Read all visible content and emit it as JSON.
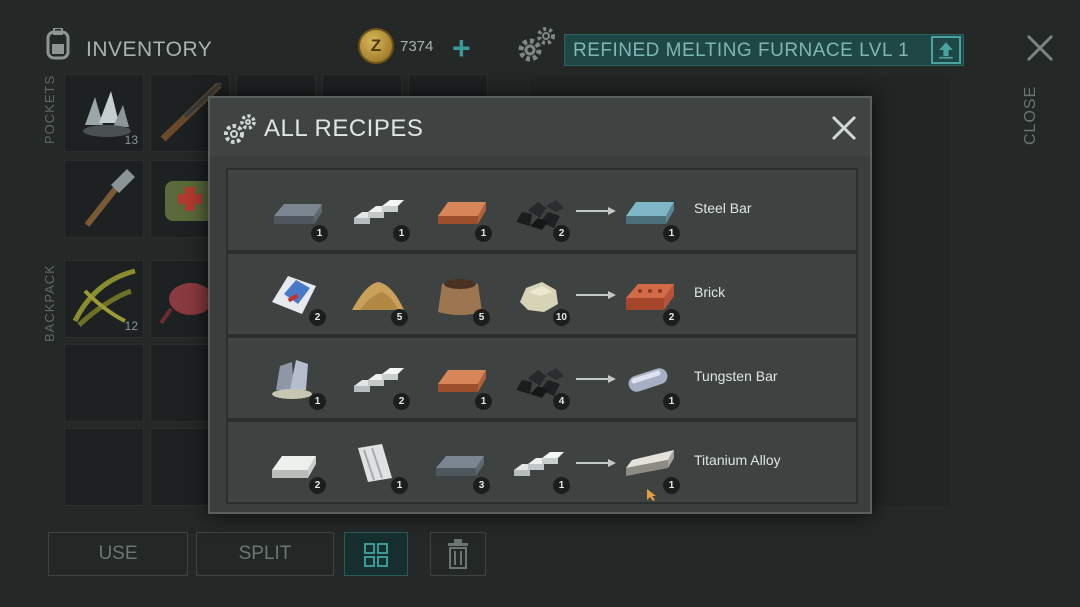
{
  "header": {
    "inventory_title": "INVENTORY",
    "coins": "7374",
    "coin_symbol": "Z",
    "plus_symbol": "+",
    "furnace_title": "REFINED MELTING FURNACE LVL 1",
    "close_label": "CLOSE"
  },
  "inventory": {
    "pockets_label": "POCKETS",
    "backpack_label": "BACKPACK",
    "slot_counts": [
      "13",
      "12"
    ]
  },
  "actions": {
    "use_label": "USE",
    "split_label": "SPLIT"
  },
  "modal": {
    "title": "ALL RECIPES",
    "recipes": [
      {
        "name": "Steel Bar",
        "ingredients": [
          {
            "icon": "iron-bar-icon",
            "count": "1"
          },
          {
            "icon": "silver-ingots-icon",
            "count": "1"
          },
          {
            "icon": "copper-bar-icon",
            "count": "1"
          },
          {
            "icon": "coal-icon",
            "count": "2"
          }
        ],
        "result": {
          "icon": "steel-bar-icon",
          "count": "1"
        }
      },
      {
        "name": "Brick",
        "ingredients": [
          {
            "icon": "cement-bag-icon",
            "count": "2"
          },
          {
            "icon": "sand-pile-icon",
            "count": "5"
          },
          {
            "icon": "soil-sack-icon",
            "count": "5"
          },
          {
            "icon": "stone-icon",
            "count": "10"
          }
        ],
        "result": {
          "icon": "brick-icon",
          "count": "2"
        }
      },
      {
        "name": "Tungsten Bar",
        "ingredients": [
          {
            "icon": "tungsten-ore-icon",
            "count": "1"
          },
          {
            "icon": "silver-ingots-icon",
            "count": "2"
          },
          {
            "icon": "copper-bar-icon",
            "count": "1"
          },
          {
            "icon": "coal-icon",
            "count": "4"
          }
        ],
        "result": {
          "icon": "tungsten-bar-icon",
          "count": "1"
        }
      },
      {
        "name": "Titanium Alloy",
        "ingredients": [
          {
            "icon": "silver-bar-icon",
            "count": "2"
          },
          {
            "icon": "titanium-sheet-icon",
            "count": "1"
          },
          {
            "icon": "iron-bar-icon",
            "count": "3"
          },
          {
            "icon": "silver-ingots-icon",
            "count": "1"
          }
        ],
        "result": {
          "icon": "titanium-alloy-icon",
          "count": "1"
        }
      }
    ]
  },
  "colors": {
    "accent": "#3b9a98",
    "modal_bg": "#3a3f3e",
    "row_bg": "#3e4342"
  }
}
